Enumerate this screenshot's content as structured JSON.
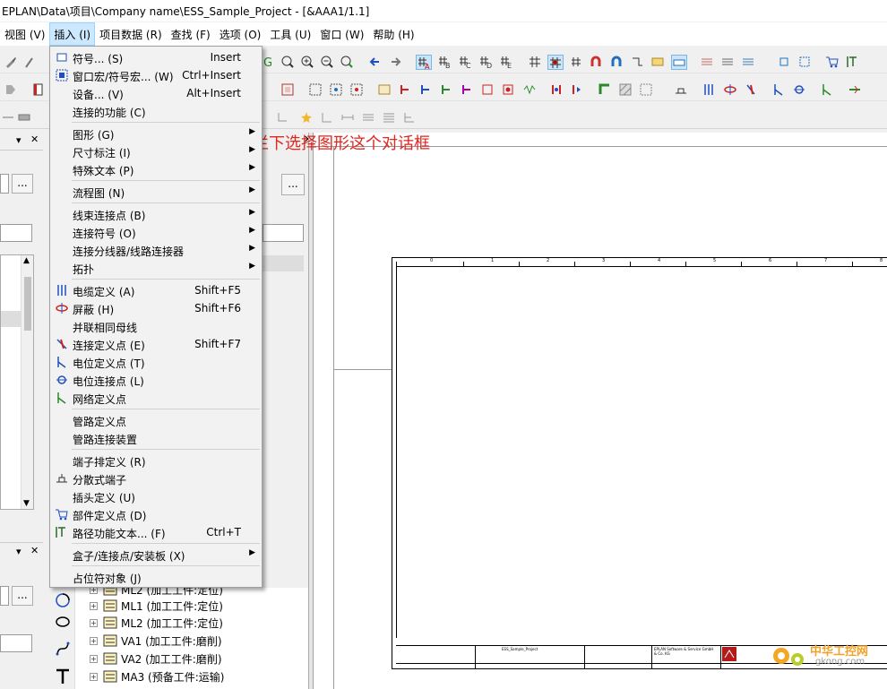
{
  "window": {
    "title": "EPLAN\\Data\\项目\\Company name\\ESS_Sample_Project - [&AAA1/1.1]"
  },
  "menubar": [
    {
      "label": "视图 (V)"
    },
    {
      "label": "插入 (I)",
      "active": true
    },
    {
      "label": "项目数据 (R)"
    },
    {
      "label": "查找 (F)"
    },
    {
      "label": "选项 (O)"
    },
    {
      "label": "工具 (U)"
    },
    {
      "label": "窗口 (W)"
    },
    {
      "label": "帮助 (H)"
    }
  ],
  "insert_menu": {
    "items": [
      {
        "label": "符号... (S)",
        "shortcut": "Insert",
        "icon": "symbol-icon"
      },
      {
        "label": "窗口宏/符号宏... (W)",
        "shortcut": "Ctrl+Insert",
        "icon": "window-macro-icon"
      },
      {
        "label": "设备... (V)",
        "shortcut": "Alt+Insert",
        "icon": ""
      },
      {
        "label": "连接的功能 (C)",
        "shortcut": "",
        "icon": ""
      },
      {
        "label": "图形 (G)",
        "shortcut": "",
        "submenu": true
      },
      {
        "label": "尺寸标注 (I)",
        "shortcut": "",
        "submenu": true
      },
      {
        "label": "特殊文本 (P)",
        "shortcut": "",
        "submenu": true
      },
      {
        "label": "流程图 (N)",
        "shortcut": "",
        "submenu": true
      },
      {
        "label": "线束连接点 (B)",
        "shortcut": "",
        "submenu": true
      },
      {
        "label": "连接符号 (O)",
        "shortcut": "",
        "submenu": true
      },
      {
        "label": "连接分线器/线路连接器",
        "shortcut": "",
        "submenu": true
      },
      {
        "label": "拓扑",
        "shortcut": "",
        "submenu": true
      },
      {
        "label": "电缆定义 (A)",
        "shortcut": "Shift+F5",
        "icon": "cable-definition-icon"
      },
      {
        "label": "屏蔽 (H)",
        "shortcut": "Shift+F6",
        "icon": "shield-icon"
      },
      {
        "label": "并联相同母线",
        "shortcut": ""
      },
      {
        "label": "连接定义点 (E)",
        "shortcut": "Shift+F7",
        "icon": "connection-definition-point-icon"
      },
      {
        "label": "电位定义点 (T)",
        "shortcut": "",
        "icon": "potential-definition-point-icon"
      },
      {
        "label": "电位连接点 (L)",
        "shortcut": "",
        "icon": "potential-connection-point-icon"
      },
      {
        "label": "网络定义点",
        "shortcut": "",
        "icon": "network-definition-point-icon"
      },
      {
        "label": "管路定义点",
        "shortcut": ""
      },
      {
        "label": "管路连接装置",
        "shortcut": ""
      },
      {
        "label": "端子排定义 (R)",
        "shortcut": ""
      },
      {
        "label": "分散式端子",
        "shortcut": "",
        "icon": "distributed-terminal-icon"
      },
      {
        "label": "插头定义 (U)",
        "shortcut": ""
      },
      {
        "label": "部件定义点 (D)",
        "shortcut": "",
        "icon": "part-definition-point-icon"
      },
      {
        "label": "路径功能文本... (F)",
        "shortcut": "Ctrl+T",
        "icon": "path-function-text-icon"
      },
      {
        "label": "盒子/连接点/安装板 (X)",
        "shortcut": "",
        "submenu": true
      },
      {
        "label": "占位符对象 (J)",
        "shortcut": ""
      }
    ]
  },
  "annotation": {
    "text": "在插入菜单拦下选择图形这个对话框"
  },
  "tree": {
    "rows": [
      {
        "label": "ML2 (加工工件:定位)",
        "partial": true
      },
      {
        "label": "ML1 (加工工件:定位)"
      },
      {
        "label": "ML2 (加工工件:定位)"
      },
      {
        "label": "VA1 (加工工件:磨削)"
      },
      {
        "label": "VA2 (加工工件:磨削)"
      },
      {
        "label": "MA3 (预备工件:运输)"
      }
    ]
  },
  "panel": {
    "more_label": "..."
  },
  "sheet": {
    "column_numbers": [
      "0",
      "1",
      "2",
      "3",
      "4",
      "5",
      "6",
      "7",
      "8"
    ],
    "title_block": {
      "project": "ESS_Sample_Project",
      "company": "EPLAN Software & Service GmbH & Co. KG"
    }
  },
  "watermark": {
    "name": "中华工控网",
    "url": "gkong.com"
  },
  "colors": {
    "menu_active": "#cce8ff",
    "annotation": "#e0261f",
    "toolbar_selected": "#cce4f7"
  }
}
